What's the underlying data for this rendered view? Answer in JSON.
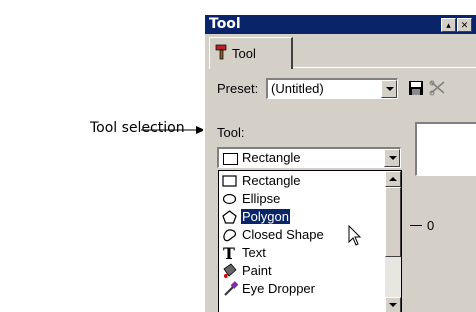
{
  "callout": {
    "text": "Tool selection"
  },
  "window": {
    "title": "Tool",
    "title_buttons": [
      "▴",
      "✕"
    ],
    "tab_label": "Tool",
    "preset_label": "Preset:",
    "preset_value": "(Untitled)",
    "tool_label": "Tool:",
    "tool_value": "Rectangle",
    "side_value": "0"
  },
  "tool_list": {
    "items": [
      {
        "label": "Rectangle",
        "icon": "rectangle-icon"
      },
      {
        "label": "Ellipse",
        "icon": "ellipse-icon"
      },
      {
        "label": "Polygon",
        "icon": "polygon-icon",
        "selected": true
      },
      {
        "label": "Closed Shape",
        "icon": "closed-shape-icon"
      },
      {
        "label": "Text",
        "icon": "text-icon"
      },
      {
        "label": "Paint",
        "icon": "paint-icon"
      },
      {
        "label": "Eye Dropper",
        "icon": "eye-dropper-icon"
      }
    ]
  },
  "colors": {
    "titlebar": "#0a246a",
    "face": "#d4d0c8",
    "selection": "#0a246a"
  }
}
